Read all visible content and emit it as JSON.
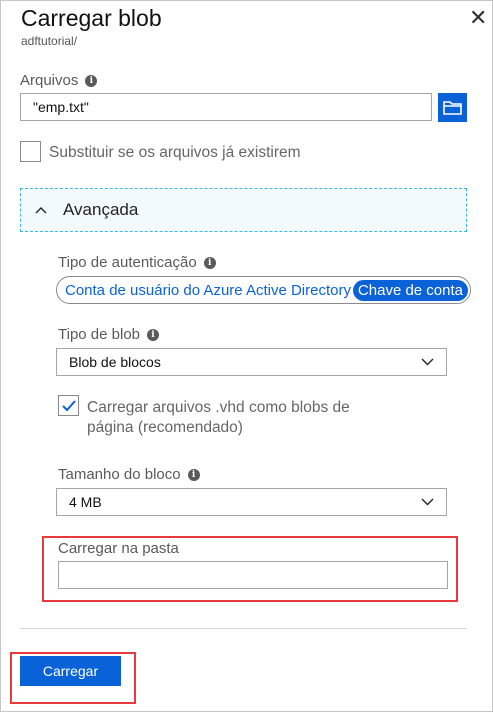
{
  "header": {
    "title": "Carregar blob",
    "subtitle": "adftutorial/",
    "close": "✕"
  },
  "files": {
    "label": "Arquivos",
    "value": "\"emp.txt\""
  },
  "overwrite": {
    "label": "Substituir se os arquivos já existirem",
    "checked": false
  },
  "advanced": {
    "label": "Avançada",
    "expanded": true
  },
  "auth": {
    "label": "Tipo de autenticação",
    "options": [
      "Conta de usuário do Azure Active Directory",
      "Chave de conta"
    ],
    "selected": "Chave de conta"
  },
  "blob_type": {
    "label": "Tipo de blob",
    "value": "Blob de blocos"
  },
  "vhd": {
    "label_line1": "Carregar arquivos .vhd como blobs de",
    "label_line2": "página (recomendado)",
    "checked": true
  },
  "block_size": {
    "label": "Tamanho do bloco",
    "value": "4 MB"
  },
  "folder": {
    "label": "Carregar na pasta",
    "value": ""
  },
  "upload_button": "Carregar",
  "colors": {
    "accent": "#0a62d8",
    "highlight": "#e8393d"
  }
}
